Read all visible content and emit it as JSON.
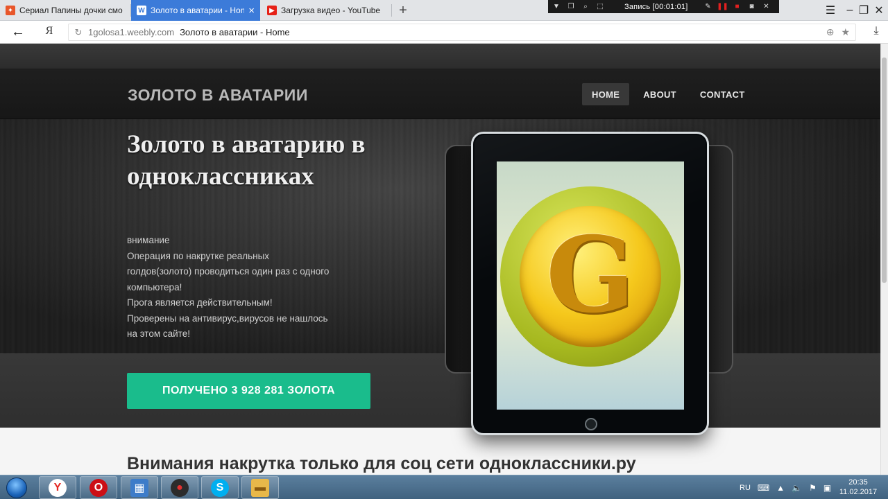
{
  "browser": {
    "tabs": [
      {
        "label": "Сериал Папины дочки смо",
        "icon": "fire-icon",
        "active": false
      },
      {
        "label": "Золото в аватарии - Hon",
        "icon": "weebly-icon",
        "active": true
      },
      {
        "label": "Загрузка видео - YouTube",
        "icon": "youtube-icon",
        "active": false
      }
    ],
    "new_tab_label": "+",
    "recorder_label": "Запись [00:01:01]",
    "address": {
      "domain": "1golosa1.weebly.com",
      "title": "Золото в аватарии - Home",
      "search_engine_label": "Я"
    }
  },
  "site": {
    "title": "ЗОЛОТО В АВАТАРИИ",
    "nav": [
      {
        "label": "HOME",
        "active": true
      },
      {
        "label": "ABOUT",
        "active": false
      },
      {
        "label": "CONTACT",
        "active": false
      }
    ],
    "hero": {
      "heading": "Золото в аватарию в одноклассниках",
      "lines": [
        "внимание",
        "Операция по накрутке реальных",
        "голдов(золото)  проводиться один раз с одного",
        "компьютера!",
        "Прога является действительным!",
        "Проверены на антивирус,вирусов не нашлось",
        "на этом сайте!"
      ]
    },
    "cta_label": "ПОЛУЧЕНО 3 928 281 ЗОЛОТА",
    "section_heading": "Внимания накрутка только для соц сети одноклассники.ру",
    "coin_letter": "G"
  },
  "taskbar": {
    "apps": [
      {
        "name": "yandex-browser",
        "glyph": "Y",
        "color": "#e52620"
      },
      {
        "name": "opera",
        "glyph": "O",
        "color": "#cc0f16"
      },
      {
        "name": "control-panel",
        "glyph": "▦",
        "color": "#3d7cc9"
      },
      {
        "name": "screen-recorder",
        "glyph": "●",
        "color": "#c81d1d"
      },
      {
        "name": "skype",
        "glyph": "S",
        "color": "#00aff0"
      },
      {
        "name": "file-explorer",
        "glyph": "▬",
        "color": "#e8b84a"
      }
    ],
    "language": "RU",
    "time": "20:35",
    "date": "11.02.2017"
  },
  "colors": {
    "cta": "#1abc8c",
    "active_tab": "#3c7bd9",
    "coin_gold": "#f5c81c",
    "coin_rim": "#a6b81f"
  }
}
